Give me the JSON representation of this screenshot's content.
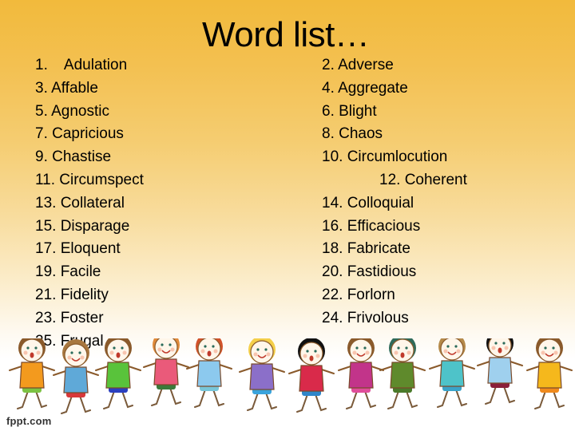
{
  "slide": {
    "title": "Word list…",
    "watermark": "fppt.com",
    "background_colors": {
      "top": "#f2ba3c",
      "bottom": "#ffffff"
    }
  },
  "word_list": {
    "left_column": [
      "1.    Adulation",
      "3. Affable",
      "5. Agnostic",
      "7. Capricious",
      "9. Chastise",
      "11. Circumspect",
      "13. Collateral",
      "15. Disparage",
      "17. Eloquent",
      "19. Facile",
      "21. Fidelity",
      "23. Foster",
      "25. Frugal"
    ],
    "right_column": [
      "2. Adverse",
      "4. Aggregate",
      "6. Blight",
      "8. Chaos",
      "10. Circumlocution",
      "12. Coherent",
      "14. Colloquial",
      "16. Efficacious",
      "18. Fabricate",
      "20. Fastidious",
      "22. Forlorn",
      "24. Frivolous"
    ]
  },
  "illustration": {
    "description": "row-of-cartoon-children-holding-hands",
    "kids": [
      {
        "hair": "#8a5a2b",
        "shirt": "#f39a1e",
        "pants": "#7cc242"
      },
      {
        "hair": "#a8773f",
        "shirt": "#5fa9d8",
        "pants": "#d8383a"
      },
      {
        "hair": "#8a5a2b",
        "shirt": "#59c33b",
        "pants": "#2b3fbf"
      },
      {
        "hair": "#e08a3a",
        "shirt": "#ea5a7a",
        "pants": "#3b7a3b"
      },
      {
        "hair": "#d1522a",
        "shirt": "#8cc9ee",
        "pants": "#78c6d8"
      },
      {
        "hair": "#f4cf4a",
        "shirt": "#8b6fc9",
        "pants": "#3aa3dc"
      },
      {
        "hair": "#111111",
        "shirt": "#d92a4a",
        "pants": "#2f86c9"
      },
      {
        "hair": "#8a5a2b",
        "shirt": "#c2348a",
        "pants": "#e04d9a"
      },
      {
        "hair": "#2f6b5a",
        "shirt": "#5f8a2c",
        "pants": "#4a7a2a"
      },
      {
        "hair": "#b58a4a",
        "shirt": "#4ec3c9",
        "pants": "#3aa3c9"
      },
      {
        "hair": "#111111",
        "shirt": "#9fd0ee",
        "pants": "#8a1f3a"
      },
      {
        "hair": "#8a5a2b",
        "shirt": "#f5b81c",
        "pants": "#f08a1c"
      }
    ]
  }
}
